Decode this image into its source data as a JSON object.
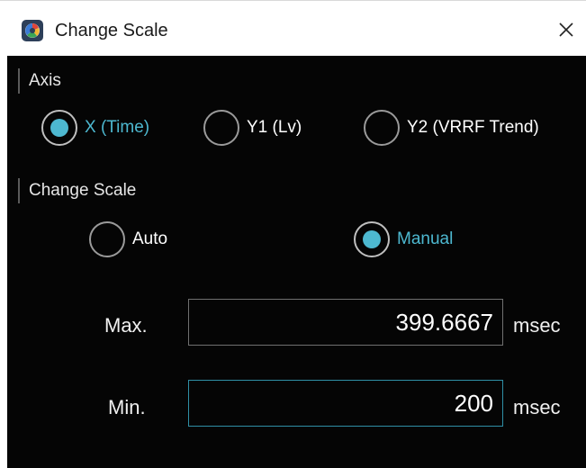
{
  "window": {
    "title": "Change Scale",
    "app_icon": "app-logo-icon",
    "close_icon": "close-icon"
  },
  "axis_section": {
    "label": "Axis",
    "options": [
      {
        "label": "X (Time)",
        "checked": true
      },
      {
        "label": "Y1 (Lv)",
        "checked": false
      },
      {
        "label": "Y2 (VRRF Trend)",
        "checked": false
      }
    ]
  },
  "scale_section": {
    "label": "Change Scale",
    "options": [
      {
        "label": "Auto",
        "checked": false
      },
      {
        "label": "Manual",
        "checked": true
      }
    ]
  },
  "max_field": {
    "label": "Max.",
    "value": "399.6667",
    "unit": "msec"
  },
  "min_field": {
    "label": "Min.",
    "value": "200",
    "unit": "msec"
  },
  "colors": {
    "accent": "#4db8d0",
    "background": "#050505",
    "focus_border": "#2f8fa6"
  }
}
